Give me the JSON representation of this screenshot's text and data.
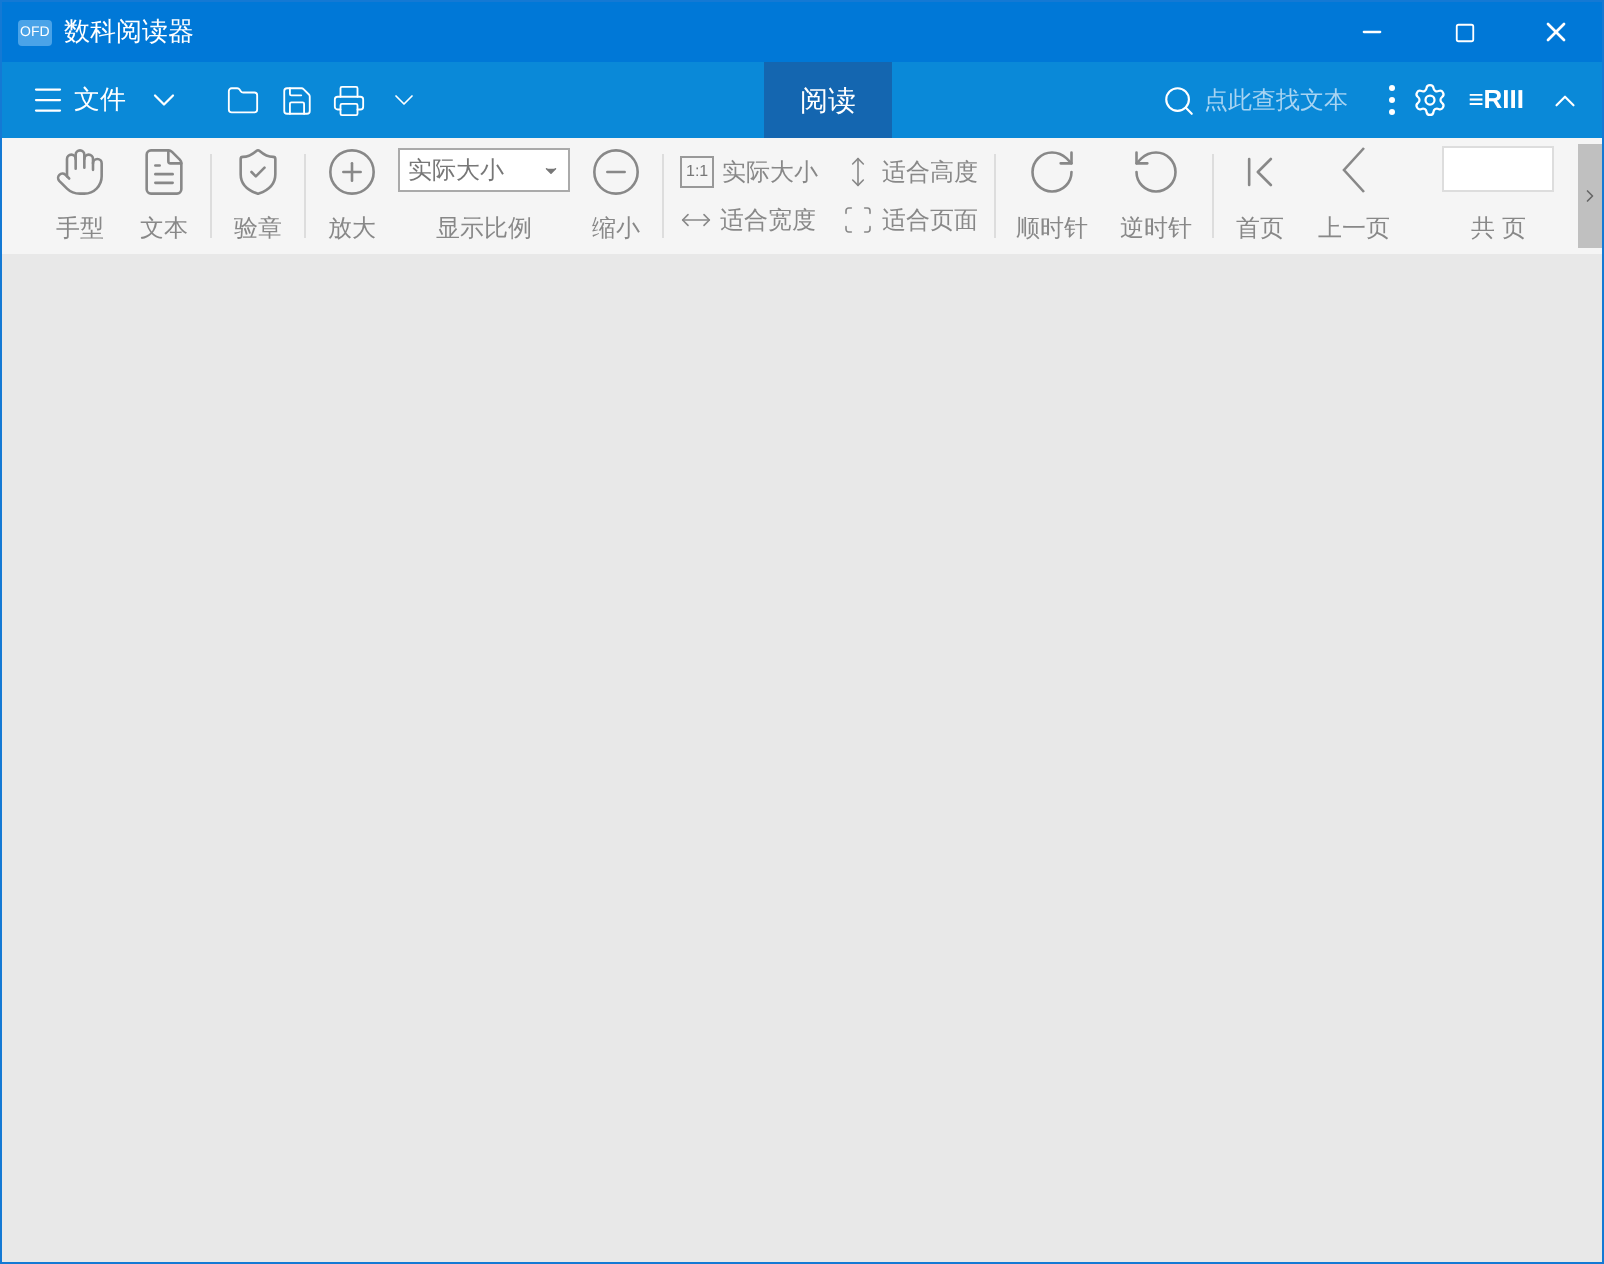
{
  "window": {
    "app_icon_text": "OFD",
    "title": "数科阅读器"
  },
  "menubar": {
    "file_menu": "文件",
    "tabs": [
      {
        "label": "阅读",
        "selected": true
      }
    ],
    "search": {
      "placeholder": "点此查找文本"
    },
    "logo_text": "≡RIII"
  },
  "toolbar": [
    {
      "kind": "big",
      "label": "手型"
    },
    {
      "kind": "big",
      "label": "文本"
    },
    {
      "kind": "divider"
    },
    {
      "kind": "big",
      "label": "验章"
    },
    {
      "kind": "divider"
    },
    {
      "kind": "big",
      "label": "放大"
    },
    {
      "kind": "combo",
      "value": "实际大小",
      "label": "显示比例"
    },
    {
      "kind": "big",
      "label": "缩小"
    },
    {
      "kind": "divider"
    },
    {
      "kind": "pair",
      "items": [
        {
          "icon_text": "1:1",
          "label": "实际大小"
        },
        {
          "label": "适合宽度"
        }
      ]
    },
    {
      "kind": "pair",
      "items": [
        {
          "label": "适合高度"
        },
        {
          "label": "适合页面"
        }
      ]
    },
    {
      "kind": "divider"
    },
    {
      "kind": "big",
      "label": "顺时针"
    },
    {
      "kind": "big",
      "label": "逆时针"
    },
    {
      "kind": "divider"
    },
    {
      "kind": "big",
      "label": "首页"
    },
    {
      "kind": "big",
      "label": "上一页"
    },
    {
      "kind": "page",
      "label": "共 页"
    }
  ]
}
